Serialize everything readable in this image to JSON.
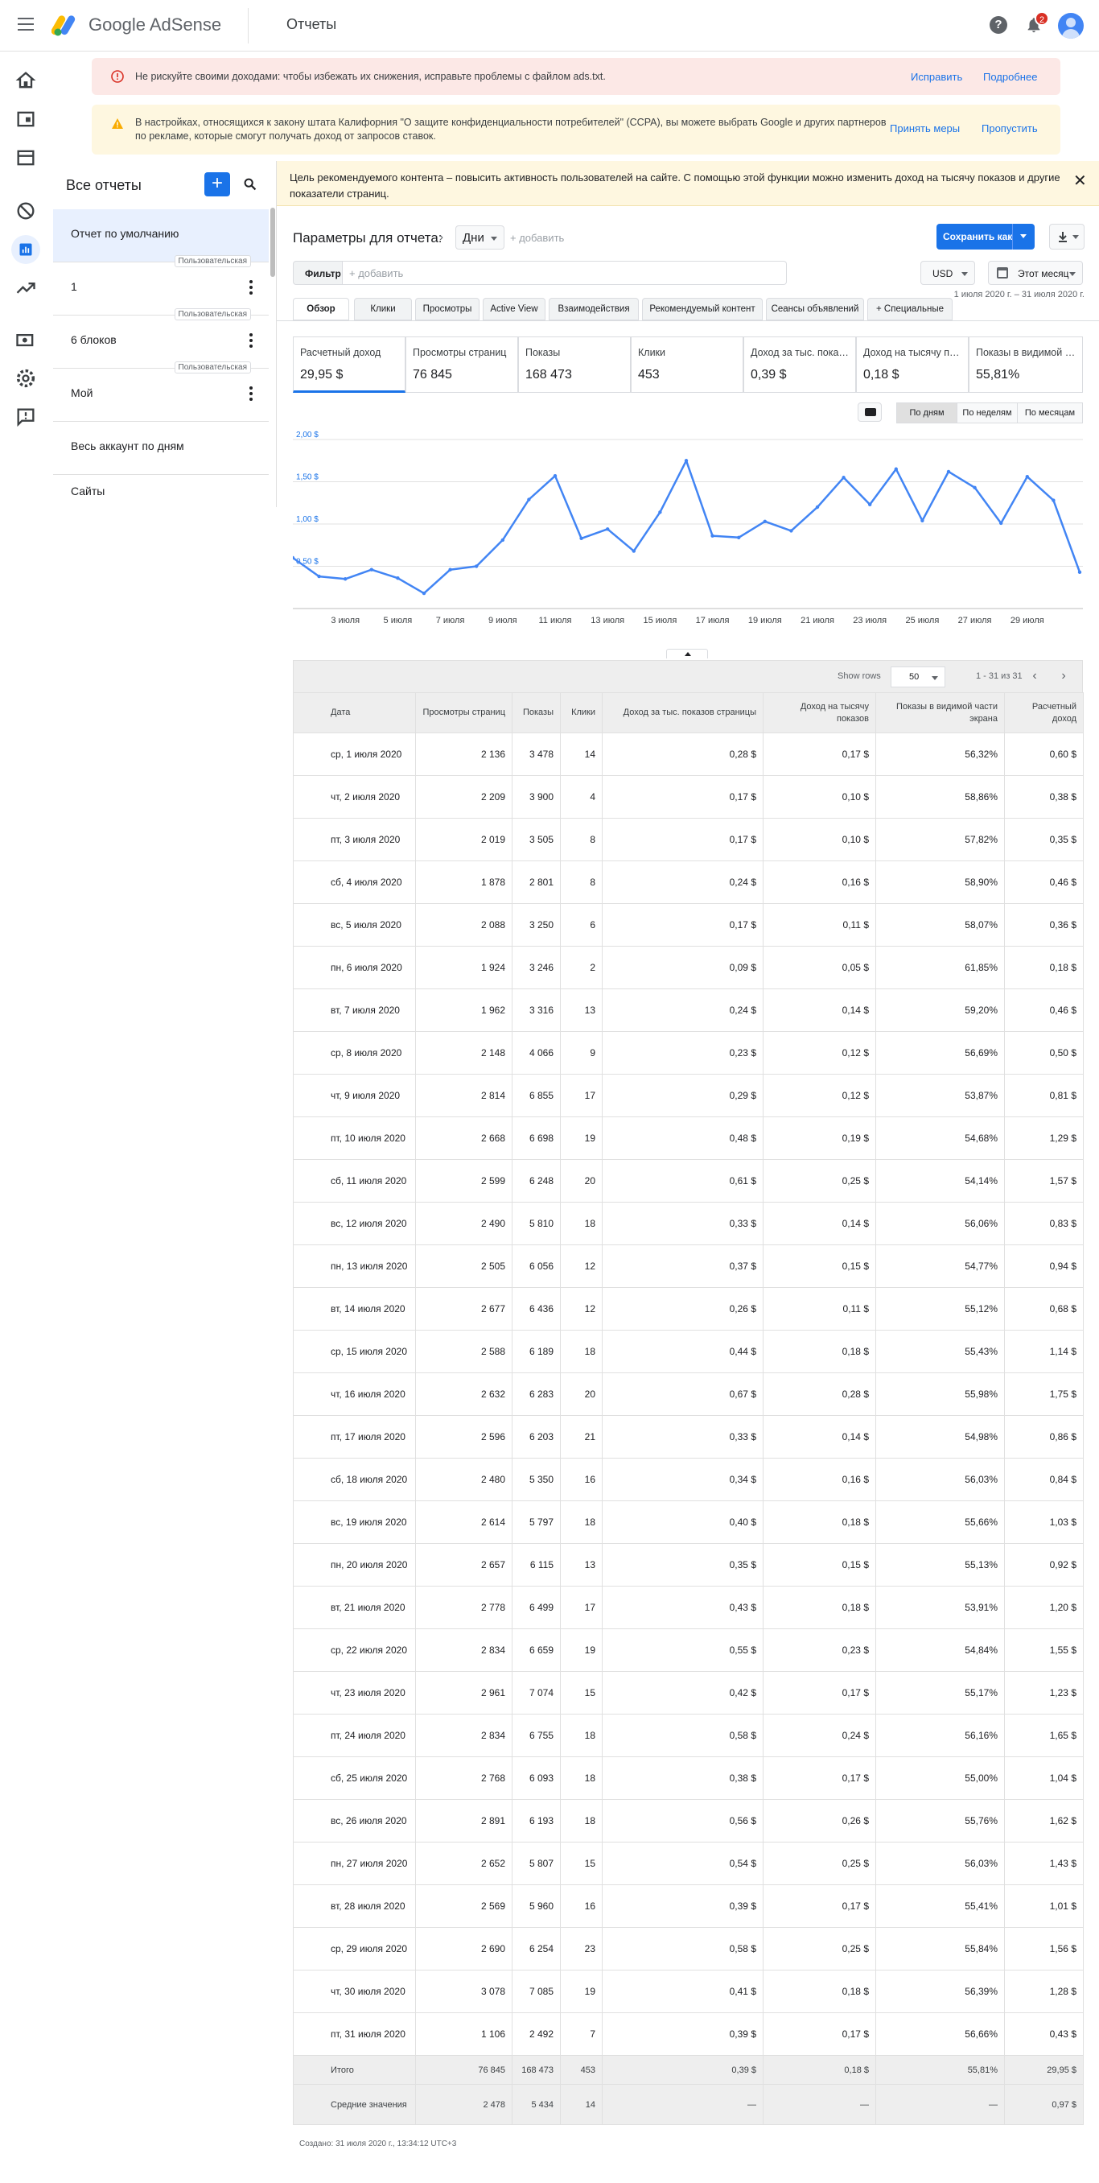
{
  "header": {
    "brand_google": "Google",
    "brand_product": "AdSense",
    "page_title": "Отчеты",
    "notifications_count": "2"
  },
  "banners": [
    {
      "text": "Не рискуйте своими доходами: чтобы избежать их снижения, исправьте проблемы с файлом ads.txt.",
      "action1": "Исправить",
      "action2": "Подробнее"
    },
    {
      "text": "В настройках, относящихся к закону штата Калифорния \"О защите конфиденциальности потребителей\" (CCPA), вы можете выбрать Google и других партнеров по рекламе, которые смогут получать доход от запросов ставок.",
      "action1": "Принять меры",
      "action2": "Пропустить"
    }
  ],
  "leftpanel": {
    "title": "Все отчеты",
    "add": "+",
    "items": [
      {
        "label": "Отчет по умолчанию",
        "tag": ""
      },
      {
        "label": "1",
        "tag": "Пользовательская"
      },
      {
        "label": "6 блоков",
        "tag": "Пользовательская"
      },
      {
        "label": "Мой",
        "tag": "Пользовательская"
      },
      {
        "label": "Весь аккаунт по дням",
        "tag": ""
      },
      {
        "label": "Сайты",
        "tag": ""
      }
    ]
  },
  "infobar": {
    "text": "Цель рекомендуемого контента – повысить активность пользователей на сайте. С помощью этой функции можно изменить доход на тысячу показов и другие показатели страниц.",
    "close": "✕"
  },
  "params": {
    "title": "Параметры для отчета:",
    "dimension": "Дни",
    "add": "+ добавить",
    "save": "Сохранить как",
    "filter_label": "Фильтр",
    "filter_placeholder": "+ добавить",
    "currency": "USD",
    "period": "Этот месяц",
    "range": "1 июля 2020 г. – 31 июля 2020 г."
  },
  "tabs": [
    "Обзор",
    "Клики",
    "Просмотры",
    "Active View",
    "Взаимодействия",
    "Рекомендуемый контент",
    "Сеансы объявлений",
    "+  Специальные"
  ],
  "metrics": [
    {
      "label": "Расчетный доход",
      "value": "29,95 $"
    },
    {
      "label": "Просмотры страниц",
      "value": "76 845"
    },
    {
      "label": "Показы",
      "value": "168 473"
    },
    {
      "label": "Клики",
      "value": "453"
    },
    {
      "label": "Доход за тыс. показов страницы",
      "value": "0,39 $"
    },
    {
      "label": "Доход на тысячу показов",
      "value": "0,18 $"
    },
    {
      "label": "Показы в видимой части экрана",
      "value": "55,81%"
    }
  ],
  "periods": [
    "По дням",
    "По неделям",
    "По месяцам"
  ],
  "chart_data": {
    "type": "line",
    "x": [
      "1",
      "2",
      "3",
      "4",
      "5",
      "6",
      "7",
      "8",
      "9",
      "10",
      "11",
      "12",
      "13",
      "14",
      "15",
      "16",
      "17",
      "18",
      "19",
      "20",
      "21",
      "22",
      "23",
      "24",
      "25",
      "26",
      "27",
      "28",
      "29",
      "30",
      "31"
    ],
    "xticks": [
      "3 июля",
      "5 июля",
      "7 июля",
      "9 июля",
      "11 июля",
      "13 июля",
      "15 июля",
      "17 июля",
      "19 июля",
      "21 июля",
      "23 июля",
      "25 июля",
      "27 июля",
      "29 июля"
    ],
    "xtick_days": [
      3,
      5,
      7,
      9,
      11,
      13,
      15,
      17,
      19,
      21,
      23,
      25,
      27,
      29
    ],
    "yticks": [
      "2,00 $",
      "1,50 $",
      "1,00 $",
      "0,50 $"
    ],
    "ytick_values": [
      2.0,
      1.5,
      1.0,
      0.5
    ],
    "ylim": [
      0,
      2.0
    ],
    "series": [
      {
        "values": [
          0.6,
          0.38,
          0.35,
          0.46,
          0.36,
          0.18,
          0.46,
          0.5,
          0.81,
          1.29,
          1.57,
          0.83,
          0.94,
          0.68,
          1.14,
          1.75,
          0.86,
          0.84,
          1.03,
          0.92,
          1.2,
          1.55,
          1.23,
          1.65,
          1.04,
          1.62,
          1.43,
          1.01,
          1.56,
          1.28,
          0.43
        ]
      }
    ],
    "color": "#4285f4",
    "grid": true
  },
  "table": {
    "show_rows_label": "Show rows",
    "rows_per_page": "50",
    "page_info": "1 - 31 из 31",
    "columns": [
      "Дата",
      "Просмотры страниц",
      "Показы",
      "Клики",
      "Доход за тыс. показов страницы",
      "Доход на тысячу показов",
      "Показы в видимой части экрана",
      "Расчетный доход"
    ],
    "rows": [
      [
        "ср, 1 июля 2020",
        "2 136",
        "3 478",
        "14",
        "0,28 $",
        "0,17 $",
        "56,32%",
        "0,60 $"
      ],
      [
        "чт, 2 июля 2020",
        "2 209",
        "3 900",
        "4",
        "0,17 $",
        "0,10 $",
        "58,86%",
        "0,38 $"
      ],
      [
        "пт, 3 июля 2020",
        "2 019",
        "3 505",
        "8",
        "0,17 $",
        "0,10 $",
        "57,82%",
        "0,35 $"
      ],
      [
        "сб, 4 июля 2020",
        "1 878",
        "2 801",
        "8",
        "0,24 $",
        "0,16 $",
        "58,90%",
        "0,46 $"
      ],
      [
        "вс, 5 июля 2020",
        "2 088",
        "3 250",
        "6",
        "0,17 $",
        "0,11 $",
        "58,07%",
        "0,36 $"
      ],
      [
        "пн, 6 июля 2020",
        "1 924",
        "3 246",
        "2",
        "0,09 $",
        "0,05 $",
        "61,85%",
        "0,18 $"
      ],
      [
        "вт, 7 июля 2020",
        "1 962",
        "3 316",
        "13",
        "0,24 $",
        "0,14 $",
        "59,20%",
        "0,46 $"
      ],
      [
        "ср, 8 июля 2020",
        "2 148",
        "4 066",
        "9",
        "0,23 $",
        "0,12 $",
        "56,69%",
        "0,50 $"
      ],
      [
        "чт, 9 июля 2020",
        "2 814",
        "6 855",
        "17",
        "0,29 $",
        "0,12 $",
        "53,87%",
        "0,81 $"
      ],
      [
        "пт, 10 июля 2020",
        "2 668",
        "6 698",
        "19",
        "0,48 $",
        "0,19 $",
        "54,68%",
        "1,29 $"
      ],
      [
        "сб, 11 июля 2020",
        "2 599",
        "6 248",
        "20",
        "0,61 $",
        "0,25 $",
        "54,14%",
        "1,57 $"
      ],
      [
        "вс, 12 июля 2020",
        "2 490",
        "5 810",
        "18",
        "0,33 $",
        "0,14 $",
        "56,06%",
        "0,83 $"
      ],
      [
        "пн, 13 июля 2020",
        "2 505",
        "6 056",
        "12",
        "0,37 $",
        "0,15 $",
        "54,77%",
        "0,94 $"
      ],
      [
        "вт, 14 июля 2020",
        "2 677",
        "6 436",
        "12",
        "0,26 $",
        "0,11 $",
        "55,12%",
        "0,68 $"
      ],
      [
        "ср, 15 июля 2020",
        "2 588",
        "6 189",
        "18",
        "0,44 $",
        "0,18 $",
        "55,43%",
        "1,14 $"
      ],
      [
        "чт, 16 июля 2020",
        "2 632",
        "6 283",
        "20",
        "0,67 $",
        "0,28 $",
        "55,98%",
        "1,75 $"
      ],
      [
        "пт, 17 июля 2020",
        "2 596",
        "6 203",
        "21",
        "0,33 $",
        "0,14 $",
        "54,98%",
        "0,86 $"
      ],
      [
        "сб, 18 июля 2020",
        "2 480",
        "5 350",
        "16",
        "0,34 $",
        "0,16 $",
        "56,03%",
        "0,84 $"
      ],
      [
        "вс, 19 июля 2020",
        "2 614",
        "5 797",
        "18",
        "0,40 $",
        "0,18 $",
        "55,66%",
        "1,03 $"
      ],
      [
        "пн, 20 июля 2020",
        "2 657",
        "6 115",
        "13",
        "0,35 $",
        "0,15 $",
        "55,13%",
        "0,92 $"
      ],
      [
        "вт, 21 июля 2020",
        "2 778",
        "6 499",
        "17",
        "0,43 $",
        "0,18 $",
        "53,91%",
        "1,20 $"
      ],
      [
        "ср, 22 июля 2020",
        "2 834",
        "6 659",
        "19",
        "0,55 $",
        "0,23 $",
        "54,84%",
        "1,55 $"
      ],
      [
        "чт, 23 июля 2020",
        "2 961",
        "7 074",
        "15",
        "0,42 $",
        "0,17 $",
        "55,17%",
        "1,23 $"
      ],
      [
        "пт, 24 июля 2020",
        "2 834",
        "6 755",
        "18",
        "0,58 $",
        "0,24 $",
        "56,16%",
        "1,65 $"
      ],
      [
        "сб, 25 июля 2020",
        "2 768",
        "6 093",
        "18",
        "0,38 $",
        "0,17 $",
        "55,00%",
        "1,04 $"
      ],
      [
        "вс, 26 июля 2020",
        "2 891",
        "6 193",
        "18",
        "0,56 $",
        "0,26 $",
        "55,76%",
        "1,62 $"
      ],
      [
        "пн, 27 июля 2020",
        "2 652",
        "5 807",
        "15",
        "0,54 $",
        "0,25 $",
        "56,03%",
        "1,43 $"
      ],
      [
        "вт, 28 июля 2020",
        "2 569",
        "5 960",
        "16",
        "0,39 $",
        "0,17 $",
        "55,41%",
        "1,01 $"
      ],
      [
        "ср, 29 июля 2020",
        "2 690",
        "6 254",
        "23",
        "0,58 $",
        "0,25 $",
        "55,84%",
        "1,56 $"
      ],
      [
        "чт, 30 июля 2020",
        "3 078",
        "7 085",
        "19",
        "0,41 $",
        "0,18 $",
        "56,39%",
        "1,28 $"
      ],
      [
        "пт, 31 июля 2020",
        "1 106",
        "2 492",
        "7",
        "0,39 $",
        "0,17 $",
        "56,66%",
        "0,43 $"
      ]
    ],
    "total": [
      "Итого",
      "76 845",
      "168 473",
      "453",
      "0,39 $",
      "0,18 $",
      "55,81%",
      "29,95 $"
    ],
    "average": [
      "Средние значения",
      "2 478",
      "5 434",
      "14",
      "—",
      "—",
      "—",
      "0,97 $"
    ]
  },
  "footer": {
    "created": "Создано: 31 июля 2020 г., 13:34:12 UTC+3"
  }
}
